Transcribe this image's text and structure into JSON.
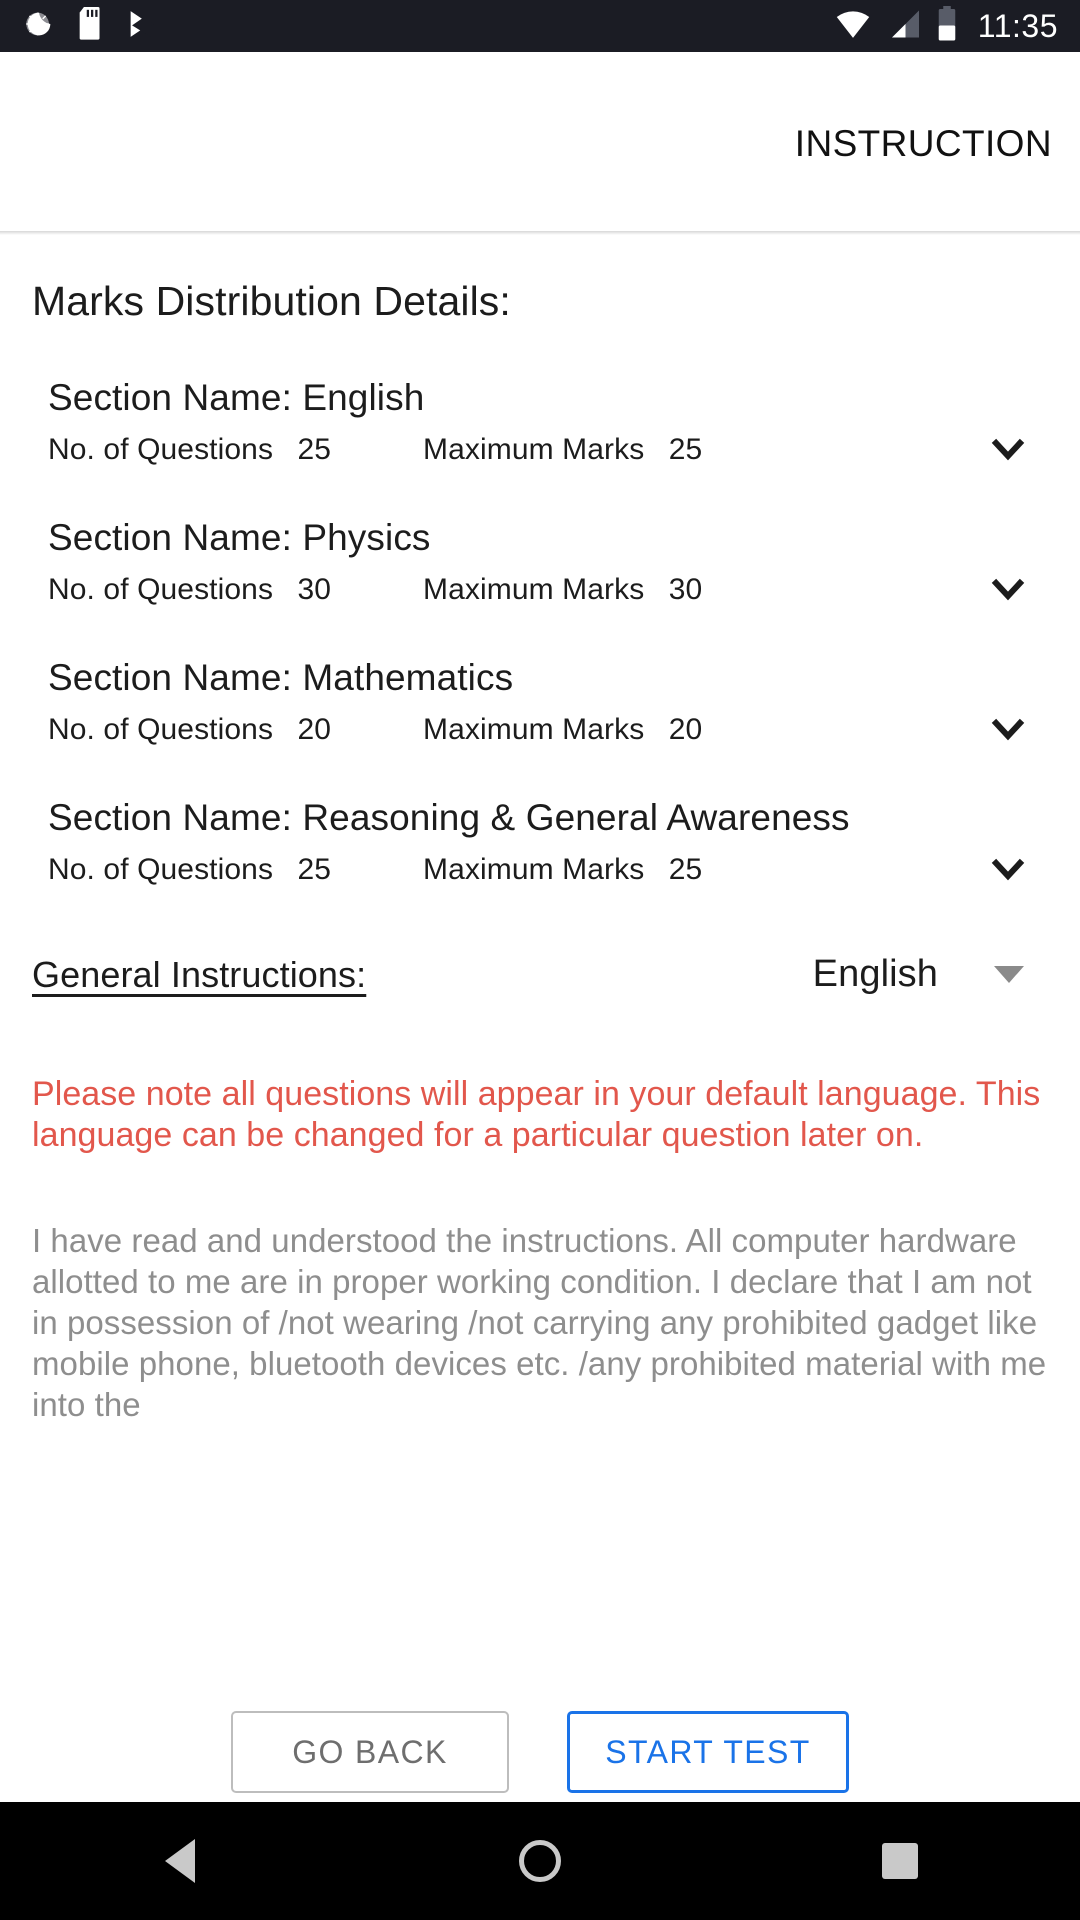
{
  "status_bar": {
    "icons_left": [
      "sync-spinner-icon",
      "sd-card-icon",
      "bluetooth-share-icon"
    ],
    "icons_right": [
      "wifi-icon",
      "cellular-signal-icon",
      "battery-icon"
    ],
    "time": "11:35"
  },
  "app_bar": {
    "title": "INSTRUCTION"
  },
  "main": {
    "page_title": "Marks Distribution Details:",
    "sections": [
      {
        "name": "Section Name: English",
        "questions_label": "No. of Questions",
        "questions_value": "25",
        "marks_label": "Maximum Marks",
        "marks_value": "25",
        "expand_icon": "chevron-down-icon"
      },
      {
        "name": "Section Name: Physics",
        "questions_label": "No. of Questions",
        "questions_value": "30",
        "marks_label": "Maximum Marks",
        "marks_value": "30",
        "expand_icon": "chevron-down-icon"
      },
      {
        "name": "Section Name: Mathematics",
        "questions_label": "No. of Questions",
        "questions_value": "20",
        "marks_label": "Maximum Marks",
        "marks_value": "20",
        "expand_icon": "chevron-down-icon"
      },
      {
        "name": "Section Name: Reasoning & General Awareness",
        "questions_label": "No. of Questions",
        "questions_value": "25",
        "marks_label": "Maximum Marks",
        "marks_value": "25",
        "expand_icon": "chevron-down-icon"
      }
    ],
    "general_instructions_label": "General Instructions:",
    "language_selected": "English",
    "language_caret_icon": "caret-down-icon",
    "warning_text": "Please note all questions will appear in your default language. This language can be changed for a particular question later on.",
    "declaration_text": "I have read and understood the instructions. All computer hardware allotted to me are in proper working condition. I declare that I am not in possession of /not wearing /not carrying any prohibited gadget like mobile phone, bluetooth devices etc. /any prohibited material with me into the"
  },
  "actions": {
    "go_back_label": "GO BACK",
    "start_test_label": "START TEST"
  },
  "nav_bar": {
    "back_icon": "nav-back-icon",
    "home_icon": "nav-home-icon",
    "recents_icon": "nav-recents-icon"
  },
  "colors": {
    "warning_red": "#e2574c",
    "primary_blue": "#1a73e8",
    "status_bar_bg": "#1b1c24",
    "declaration_gray": "#8e8e8e"
  }
}
